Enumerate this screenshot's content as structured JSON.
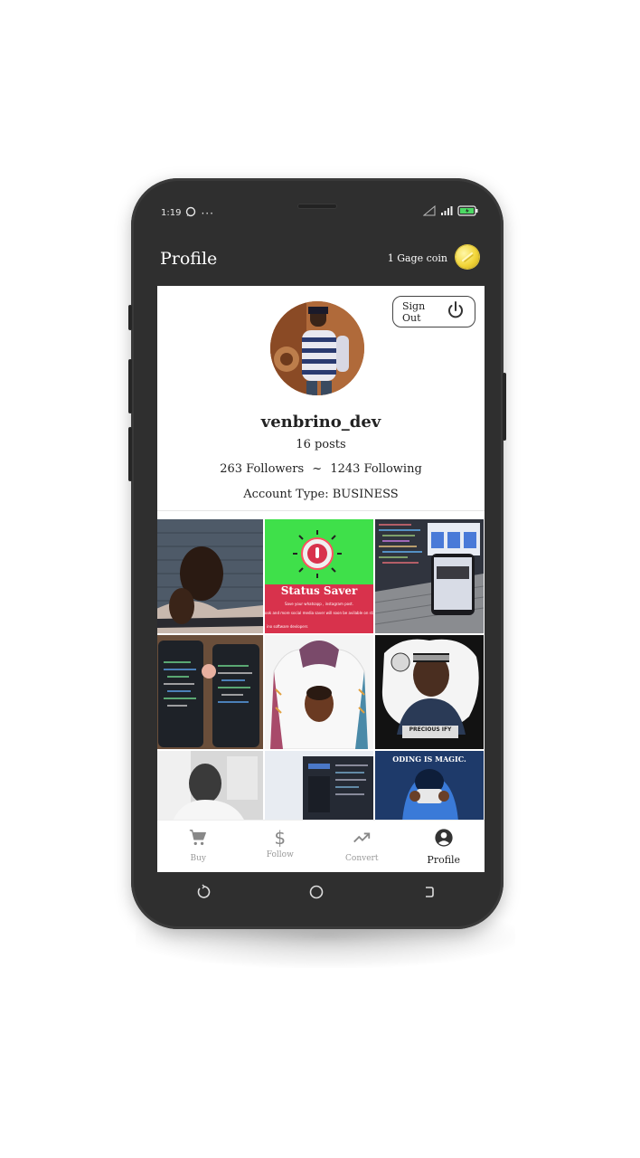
{
  "status_bar": {
    "time": "1:19",
    "dots": "···"
  },
  "app_bar": {
    "title": "Profile",
    "coin_text": "1 Gage coin"
  },
  "profile": {
    "sign_out_label": "Sign Out",
    "username": "venbrino_dev",
    "posts": "16 posts",
    "followers": "263 Followers",
    "separator": "~",
    "following": "1243 Following",
    "account_type": "Account Type: BUSINESS"
  },
  "posts_grid": {
    "status_saver_title": "Status Saver",
    "status_saver_line1": "Save your whatsapp , instagram post.",
    "status_saver_line2": "ook and more social media saver will soon be avilable on status saver",
    "status_saver_line3": "ino software devlopers",
    "precious_label": "PRECIOUS IFY",
    "coding_label": "ODING IS MAGIC."
  },
  "bottom_nav": {
    "items": [
      {
        "label": "Buy",
        "icon": "cart-icon"
      },
      {
        "label": "Follow",
        "icon": "dollar-icon"
      },
      {
        "label": "Convert",
        "icon": "trending-up-icon"
      },
      {
        "label": "Profile",
        "icon": "account-circle-icon"
      }
    ]
  },
  "colors": {
    "phone_body": "#2f2f2f",
    "coin_gold": "#f2d63a",
    "status_saver_green": "#3fe04a",
    "status_saver_red": "#d8324c"
  }
}
